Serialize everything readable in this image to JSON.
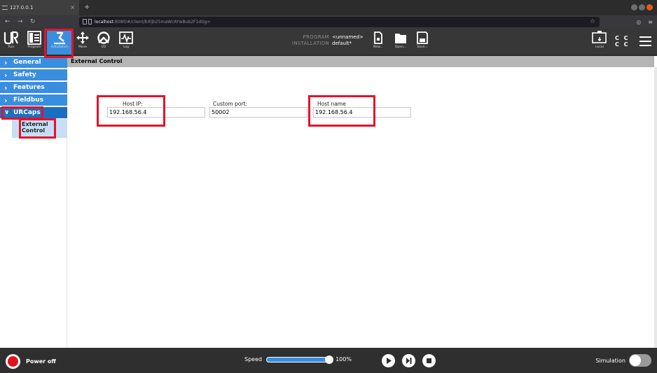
{
  "browser": {
    "tab_title": "127.0.0.1",
    "tab_close": "×",
    "new_tab": "+",
    "url_host": "localhost",
    "url_path": ":8080/#/client/bXljb25maWcAYwBub2F1dGg="
  },
  "toolbar": {
    "items": [
      {
        "label": "Run",
        "icon": "ur-logo-icon"
      },
      {
        "label": "Program",
        "icon": "program-icon"
      },
      {
        "label": "Installation",
        "icon": "installation-icon"
      },
      {
        "label": "Move",
        "icon": "move-icon"
      },
      {
        "label": "I/O",
        "icon": "io-icon"
      },
      {
        "label": "Log",
        "icon": "log-icon"
      }
    ],
    "program_key": "PROGRAM",
    "program_value": "<unnamed>",
    "installation_key": "INSTALLATION",
    "installation_value": "default*",
    "file_items": [
      {
        "label": "New...",
        "icon": "new-file-icon"
      },
      {
        "label": "Open...",
        "icon": "folder-icon"
      },
      {
        "label": "Save...",
        "icon": "save-icon"
      }
    ],
    "local_label": "Local",
    "cc_line1": "C C",
    "cc_line2": "C C"
  },
  "sidebar": {
    "items": [
      {
        "label": "General",
        "expanded": false
      },
      {
        "label": "Safety",
        "expanded": false
      },
      {
        "label": "Features",
        "expanded": false
      },
      {
        "label": "Fieldbus",
        "expanded": false
      },
      {
        "label": "URCaps",
        "expanded": true
      }
    ],
    "sub_item_line1": "External",
    "sub_item_line2": "Control"
  },
  "main": {
    "header": "External Control",
    "fields": [
      {
        "label": "Host IP:",
        "value": "192.168.56.4"
      },
      {
        "label": "Custom port:",
        "value": "50002"
      },
      {
        "label": "Host name",
        "value": "192.168.56.4"
      }
    ]
  },
  "bottom": {
    "power_label": "Power off",
    "speed_label": "Speed",
    "speed_value": "100%",
    "simulation_label": "Simulation"
  },
  "colors": {
    "accent": "#3a8ee0",
    "highlight": "#e3132b",
    "power": "#e0121e"
  }
}
